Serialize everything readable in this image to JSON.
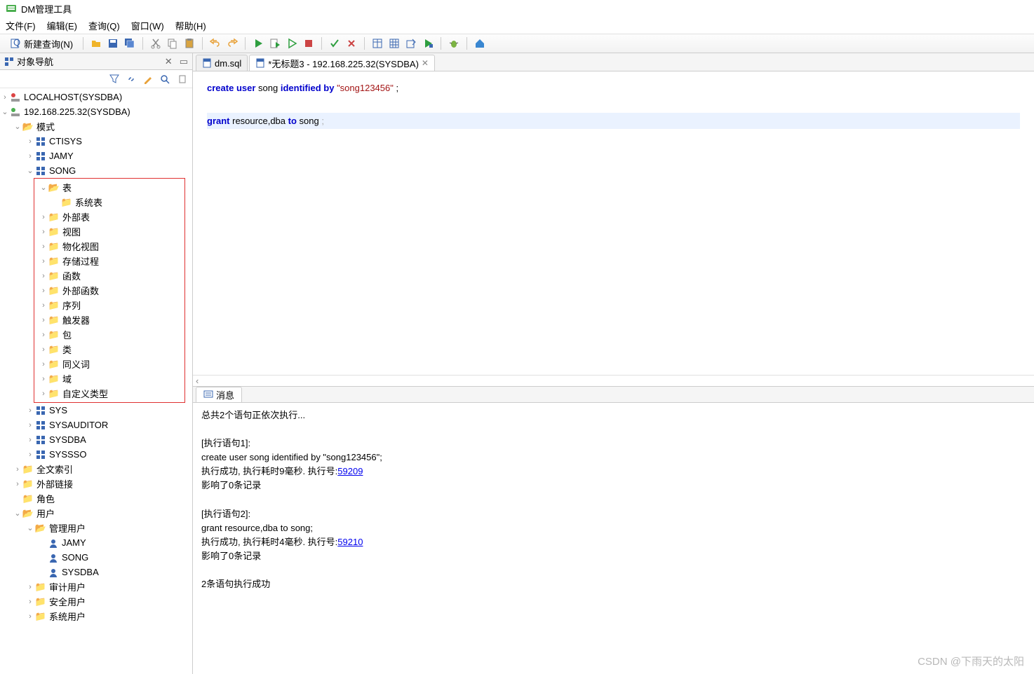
{
  "window": {
    "title": "DM管理工具"
  },
  "menu": {
    "file": "文件(F)",
    "edit": "编辑(E)",
    "query": "查询(Q)",
    "window": "窗口(W)",
    "help": "帮助(H)"
  },
  "toolbar": {
    "newQuery": "新建查询(N)"
  },
  "sidebar": {
    "tabTitle": "对象导航",
    "hosts": [
      {
        "label": "LOCALHOST(SYSDBA)",
        "connected": false
      },
      {
        "label": "192.168.225.32(SYSDBA)",
        "connected": true
      }
    ],
    "schemaRoot": "模式",
    "schemas": [
      "CTISYS",
      "JAMY",
      "SONG",
      "SYS",
      "SYSAUDITOR",
      "SYSDBA",
      "SYSSSO"
    ],
    "songChildren": {
      "tables": "表",
      "systemTables": "系统表",
      "externalTables": "外部表",
      "views": "视图",
      "materializedViews": "物化视图",
      "procedures": "存储过程",
      "functions": "函数",
      "externalFunctions": "外部函数",
      "sequences": "序列",
      "triggers": "触发器",
      "packages": "包",
      "classes": "类",
      "synonyms": "同义词",
      "domains": "域",
      "customTypes": "自定义类型"
    },
    "other": {
      "fulltextIndex": "全文索引",
      "externalLinks": "外部链接",
      "roles": "角色",
      "users": "用户",
      "mgmtUsers": "管理用户",
      "userList": [
        "JAMY",
        "SONG",
        "SYSDBA"
      ],
      "auditUsers": "审计用户",
      "securityUsers": "安全用户",
      "systemUsers": "系统用户"
    }
  },
  "editor": {
    "tabs": [
      {
        "label": "dm.sql",
        "active": false
      },
      {
        "label": "*无标题3 - 192.168.225.32(SYSDBA)",
        "active": true
      }
    ],
    "sql": {
      "l1": {
        "kw1": "create",
        "kw2": "user",
        "ident": "song",
        "kw3": "identified",
        "kw4": "by",
        "str": "\"song123456\"",
        "term": ";"
      },
      "l2": {
        "kw1": "grant",
        "args": "resource,dba",
        "kw2": "to",
        "ident": "song",
        "term": ";"
      }
    }
  },
  "output": {
    "tabTitle": "消息",
    "line1": "总共2个语句正依次执行...",
    "stmt1_header": "[执行语句1]:",
    "stmt1_sql": "create user song identified by \"song123456\";",
    "stmt1_result_prefix": "执行成功, 执行耗时9毫秒. 执行号:",
    "stmt1_exec_no": "59209",
    "stmt1_affect": "影响了0条记录",
    "stmt2_header": "[执行语句2]:",
    "stmt2_sql": "grant resource,dba to song;",
    "stmt2_result_prefix": "执行成功, 执行耗时4毫秒. 执行号:",
    "stmt2_exec_no": "59210",
    "stmt2_affect": "影响了0条记录",
    "summary": "2条语句执行成功"
  },
  "watermark": "CSDN @下雨天的太阳"
}
